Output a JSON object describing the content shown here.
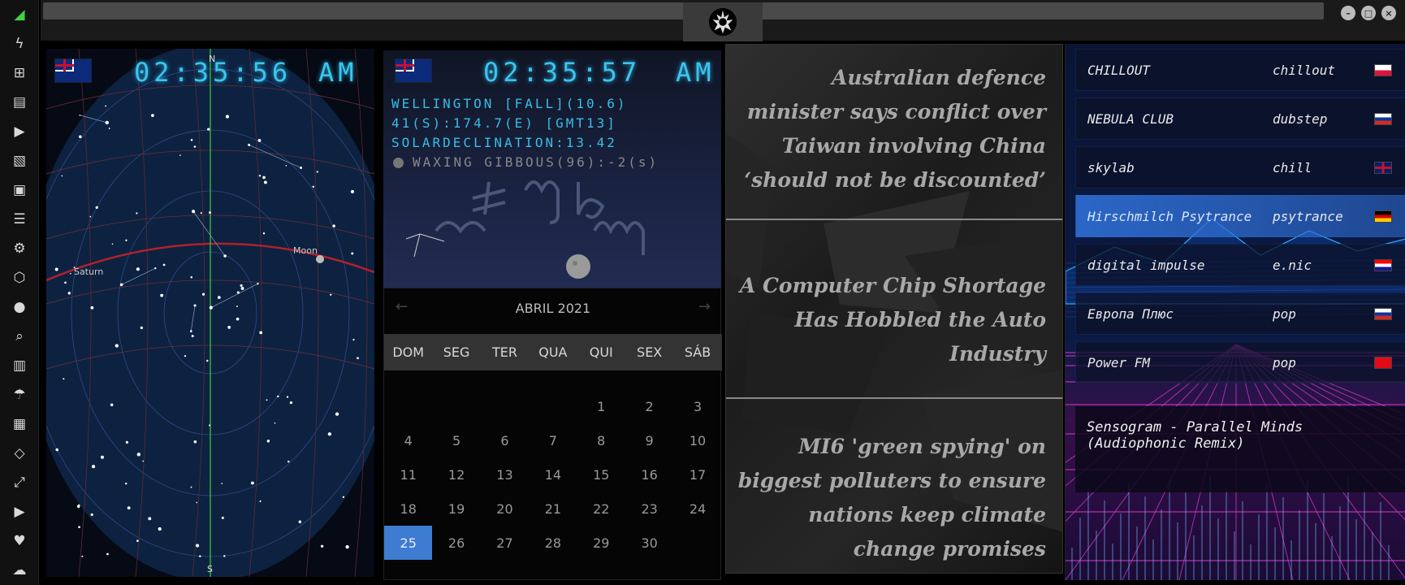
{
  "sidebar": {
    "icons": [
      "wifi-icon",
      "bolt-icon",
      "windows-icon",
      "archive-icon",
      "play-icon",
      "map-book-icon",
      "image-icon",
      "news-icon",
      "settings-icon",
      "hexagon-icon",
      "globe-icon",
      "search-icon",
      "map-icon",
      "umbrella-icon",
      "contacts-icon",
      "code-icon",
      "expand-icon",
      "youtube-icon",
      "heart-icon",
      "cloud-icon"
    ],
    "glyphs": [
      "◢",
      "ϟ",
      "⊞",
      "▤",
      "▶",
      "▧",
      "▣",
      "☰",
      "⚙",
      "⬡",
      "●",
      "⌕",
      "▥",
      "☂",
      "▦",
      "◇",
      "⤢",
      "▶",
      "♥",
      "☁"
    ]
  },
  "window": {
    "min_label": "–",
    "max_label": "□",
    "close_label": "×",
    "logo": "✦"
  },
  "starmap": {
    "time": "02:35:56",
    "ampm": "AM",
    "north": "N",
    "south": "S",
    "labels": {
      "saturn": "Saturn",
      "moon": "Moon"
    }
  },
  "clockpanel": {
    "time": "02:35:57",
    "ampm": "AM",
    "line1": "WELLINGTON [FALL](10.6)",
    "line2": "41(S):174.7(E) [GMT13]",
    "line3": "SOLARDECLINATION:13.42",
    "line4": "WAXING GIBBOUS(96):-2(s)"
  },
  "calendar": {
    "month_label": "ABRIL 2021",
    "prev": "←",
    "next": "→",
    "weekdays": [
      "DOM",
      "SEG",
      "TER",
      "QUA",
      "QUI",
      "SEX",
      "SÁB"
    ],
    "days": [
      "",
      "",
      "",
      "",
      "1",
      "2",
      "3",
      "4",
      "5",
      "6",
      "7",
      "8",
      "9",
      "10",
      "11",
      "12",
      "13",
      "14",
      "15",
      "16",
      "17",
      "18",
      "19",
      "20",
      "21",
      "22",
      "23",
      "24",
      "25",
      "26",
      "27",
      "28",
      "29",
      "30",
      ""
    ],
    "today": "25"
  },
  "news": {
    "headlines": [
      "Australian defence minister says conflict over Taiwan involving China ‘should not be discounted’",
      "A Computer Chip Shortage Has Hobbled the Auto Industry",
      "MI6 'green spying' on biggest polluters to ensure nations keep climate change promises"
    ]
  },
  "radio": {
    "stations": [
      {
        "name": "CHILLOUT",
        "genre": "chillout",
        "flag": "poland"
      },
      {
        "name": "NEBULA CLUB",
        "genre": "dubstep",
        "flag": "russia"
      },
      {
        "name": "skylab",
        "genre": "chill",
        "flag": "uk"
      },
      {
        "name": "Hirschmilch Psytrance",
        "genre": "psytrance",
        "flag": "germany"
      },
      {
        "name": "digital impulse",
        "genre": "e.nic",
        "flag": "croatia"
      },
      {
        "name": "Европа Плюс",
        "genre": "pop",
        "flag": "russia"
      },
      {
        "name": "Power FM",
        "genre": "pop",
        "flag": "turkey"
      }
    ],
    "now_playing": "Sensogram - Parallel Minds (Audiophonic Remix)",
    "active_index": 3
  },
  "colors": {
    "lcd": "#3cc4ec",
    "today": "#3d7cd0",
    "active_station": "#2f6fd6"
  }
}
